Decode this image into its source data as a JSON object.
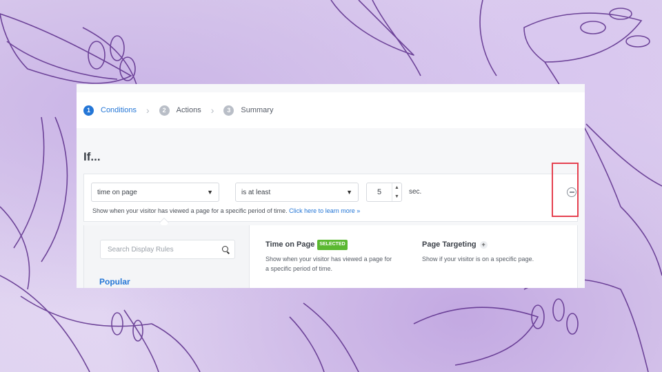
{
  "stepper": {
    "steps": [
      {
        "num": "1",
        "label": "Conditions"
      },
      {
        "num": "2",
        "label": "Actions"
      },
      {
        "num": "3",
        "label": "Summary"
      }
    ]
  },
  "rule": {
    "heading": "If...",
    "condition_value": "time on page",
    "operator_value": "is at least",
    "amount_value": "5",
    "unit": "sec.",
    "help_text": "Show when your visitor has viewed a page for a specific period of time.",
    "help_link": "Click here to learn more »"
  },
  "sidebar": {
    "search_placeholder": "Search Display Rules",
    "section_title": "Popular"
  },
  "cards": [
    {
      "title": "Time on Page",
      "badge": "SELECTED",
      "desc_line1": "Show when your visitor has viewed a page for",
      "desc_line2": "a specific period of time."
    },
    {
      "title": "Page Targeting",
      "plus": "+",
      "desc_line1": "Show if your visitor is on a specific page."
    }
  ],
  "colors": {
    "accent": "#2476d6",
    "selected_badge": "#5bb831",
    "highlight_box": "#e5404f"
  },
  "icons": [
    "chevron-right-icon",
    "chevron-down-icon",
    "search-icon",
    "remove-circle-icon",
    "plus-icon"
  ]
}
